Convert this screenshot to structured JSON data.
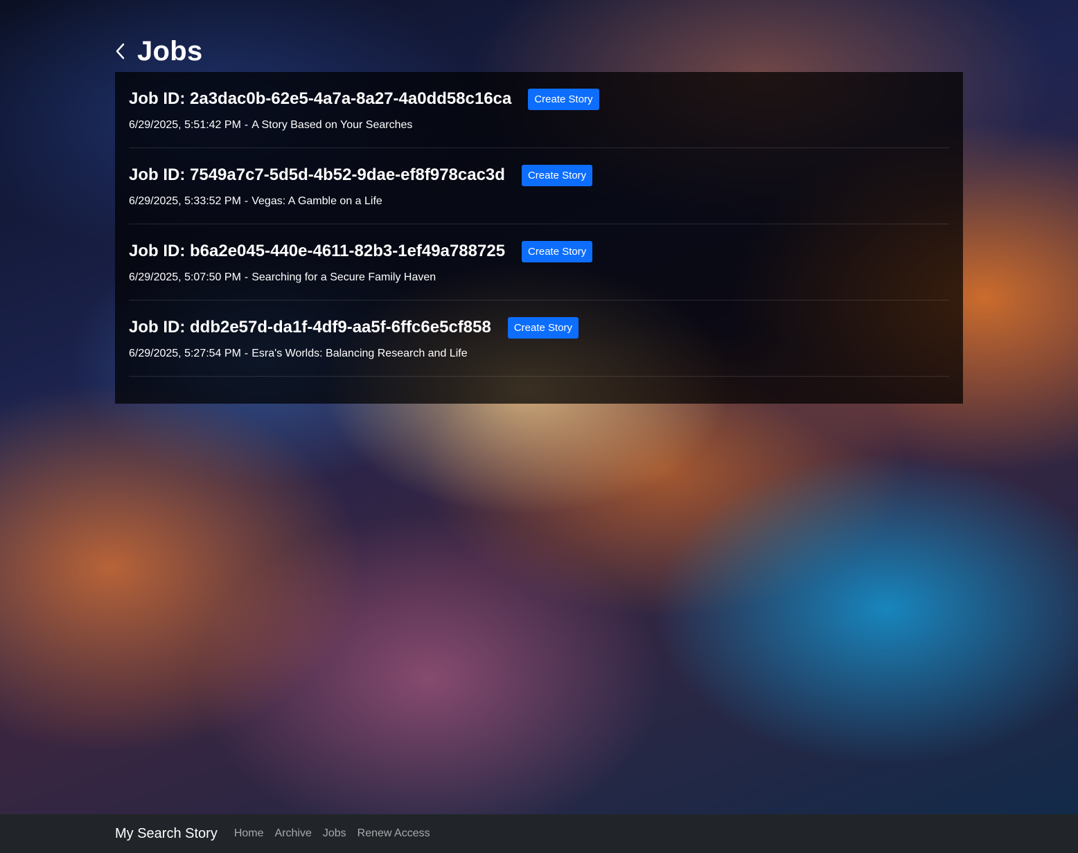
{
  "header": {
    "title": "Jobs",
    "back_icon": "chevron-left-icon"
  },
  "jobs": [
    {
      "title": "Job ID: 2a3dac0b-62e5-4a7a-8a27-4a0dd58c16ca",
      "button": "Create Story",
      "timestamp": "6/29/2025, 5:51:42 PM",
      "separator": "-",
      "story_title": "A Story Based on Your Searches"
    },
    {
      "title": "Job ID: 7549a7c7-5d5d-4b52-9dae-ef8f978cac3d",
      "button": "Create Story",
      "timestamp": "6/29/2025, 5:33:52 PM",
      "separator": "-",
      "story_title": "Vegas: A Gamble on a Life"
    },
    {
      "title": "Job ID: b6a2e045-440e-4611-82b3-1ef49a788725",
      "button": "Create Story",
      "timestamp": "6/29/2025, 5:07:50 PM",
      "separator": "-",
      "story_title": "Searching for a Secure Family Haven"
    },
    {
      "title": "Job ID: ddb2e57d-da1f-4df9-aa5f-6ffc6e5cf858",
      "button": "Create Story",
      "timestamp": "6/29/2025, 5:27:54 PM",
      "separator": "-",
      "story_title": "Esra's Worlds: Balancing Research and Life"
    }
  ],
  "footer": {
    "brand": "My Search Story",
    "nav": [
      {
        "label": "Home"
      },
      {
        "label": "Archive"
      },
      {
        "label": "Jobs"
      },
      {
        "label": "Renew Access"
      }
    ]
  },
  "colors": {
    "button_primary": "#0d6efd",
    "footer_bg": "#212529",
    "panel_bg": "rgba(0,0,0,0.72)"
  }
}
